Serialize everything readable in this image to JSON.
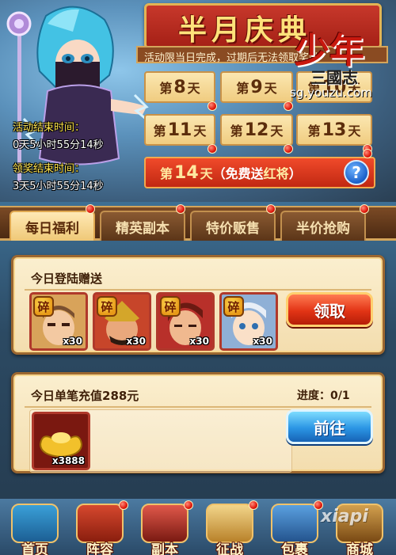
{
  "event": {
    "title": "半月庆典",
    "description": "活动限当日完成，过期后无法领取奖励",
    "logo_main": "少年",
    "logo_sub": "三國志",
    "logo_url": "sg.youzu.com"
  },
  "days": [
    {
      "prefix": "第",
      "num": "8",
      "suffix": "天"
    },
    {
      "prefix": "第",
      "num": "9",
      "suffix": "天"
    },
    {
      "prefix": "第",
      "num": "10",
      "suffix": "天"
    },
    {
      "prefix": "第",
      "num": "11",
      "suffix": "天"
    },
    {
      "prefix": "第",
      "num": "12",
      "suffix": "天"
    },
    {
      "prefix": "第",
      "num": "13",
      "suffix": "天"
    }
  ],
  "special_day": {
    "prefix": "第",
    "num": "14",
    "suffix": "天",
    "note_open": "（免费送",
    "note_reward": "红将",
    "note_close": "）"
  },
  "help_icon": "?",
  "timers": {
    "activity_label": "活动结束时间：",
    "activity_value": "0天5小时55分14秒",
    "claim_label": "领奖结束时间：",
    "claim_value": "3天5小时55分14秒"
  },
  "tabs": [
    "每日福利",
    "精英副本",
    "特价贩售",
    "半价抢购"
  ],
  "daily_login": {
    "title": "今日登陆赠送",
    "shard_badge": "碎",
    "items": [
      {
        "count": "x30",
        "color": "#d8a35a"
      },
      {
        "count": "x30",
        "color": "#c7452a"
      },
      {
        "count": "x30",
        "color": "#b8302a"
      },
      {
        "count": "x30",
        "color": "#8fb0d6"
      }
    ],
    "button": "领取"
  },
  "recharge": {
    "title": "今日单笔充值288元",
    "progress_label": "进度：",
    "progress_value": "0/1",
    "item_count": "x3888",
    "button": "前往"
  },
  "nav": [
    "首页",
    "阵容",
    "副本",
    "征战",
    "包裹",
    "商城"
  ],
  "watermark": "xiapi"
}
